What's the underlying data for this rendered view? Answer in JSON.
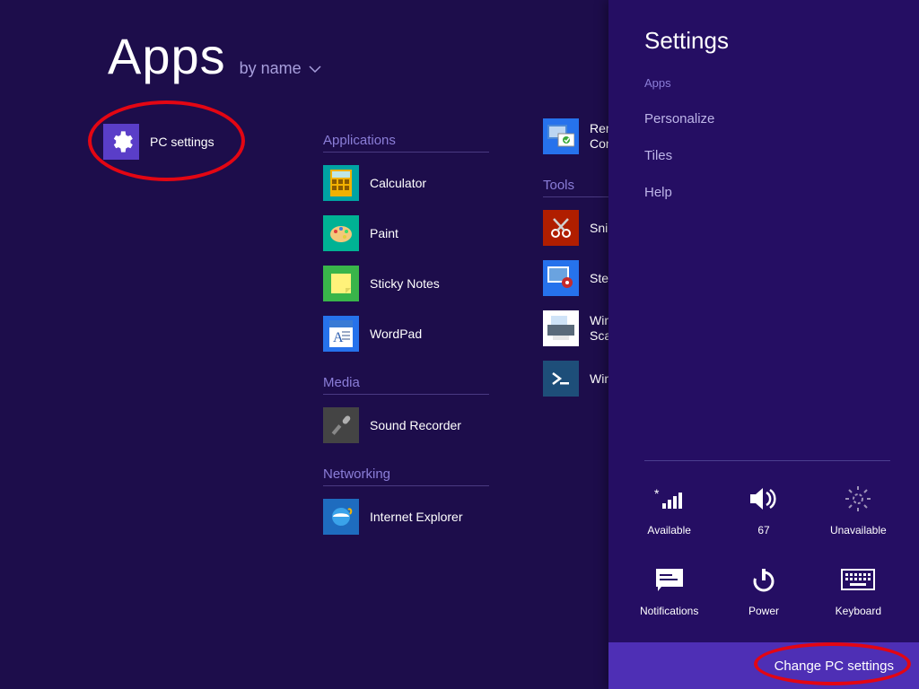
{
  "header": {
    "title": "Apps",
    "sort_label": "by name"
  },
  "col1": {
    "pc_settings": "PC settings"
  },
  "groups": {
    "applications": {
      "heading": "Applications",
      "calculator": "Calculator",
      "paint": "Paint",
      "sticky_notes": "Sticky Notes",
      "wordpad": "WordPad"
    },
    "media": {
      "heading": "Media",
      "sound_recorder": "Sound Recorder"
    },
    "networking": {
      "heading": "Networking",
      "internet_explorer": "Internet Explorer"
    },
    "col3_top": {
      "remote_desktop": "Remote Desktop Connection"
    },
    "tools": {
      "heading": "Tools",
      "snipping_tool": "Snipping Tool",
      "steps_recorder": "Steps Recorder",
      "fax_scan": "Windows Fax and Scan",
      "powershell": "Windows PowerShell"
    }
  },
  "settings": {
    "title": "Settings",
    "context": "Apps",
    "links": {
      "personalize": "Personalize",
      "tiles": "Tiles",
      "help": "Help"
    },
    "sys": {
      "network": "Available",
      "volume": "67",
      "brightness": "Unavailable",
      "notifications": "Notifications",
      "power": "Power",
      "keyboard": "Keyboard"
    },
    "footer": "Change PC settings"
  }
}
